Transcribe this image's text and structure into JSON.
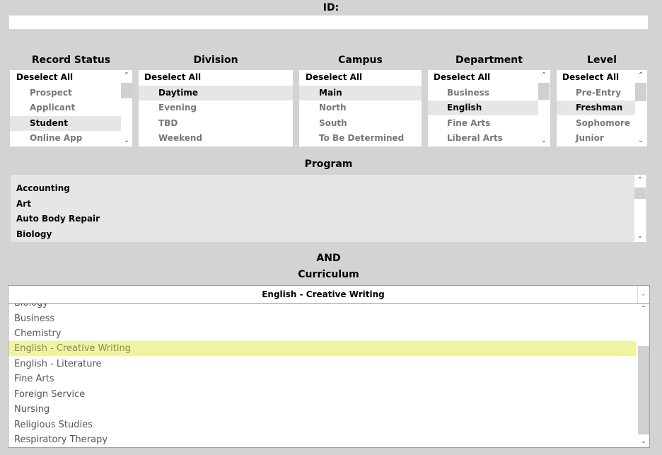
{
  "id_label": "ID:",
  "id_value": "",
  "filters": {
    "record_status": {
      "title": "Record Status",
      "deselect": "Deselect All",
      "items": [
        "Prospect",
        "Applicant",
        "Student",
        "Online App"
      ],
      "selected": "Student"
    },
    "division": {
      "title": "Division",
      "deselect": "Deselect All",
      "items": [
        "Daytime",
        "Evening",
        "TBD",
        "Weekend"
      ],
      "selected": "Daytime"
    },
    "campus": {
      "title": "Campus",
      "deselect": "Deselect All",
      "items": [
        "Main",
        "North",
        "South",
        "To Be Determined"
      ],
      "selected": "Main"
    },
    "department": {
      "title": "Department",
      "deselect": "Deselect All",
      "items": [
        "Business",
        "English",
        "Fine Arts",
        "Liberal Arts"
      ],
      "selected": "English"
    },
    "level": {
      "title": "Level",
      "deselect": "Deselect All",
      "items": [
        "Pre-Entry",
        "Freshman",
        "Sophomore",
        "Junior"
      ],
      "selected": "Freshman"
    }
  },
  "program": {
    "title": "Program",
    "items": [
      "Accounting",
      "Art",
      "Auto Body Repair",
      "Biology"
    ]
  },
  "and_label": "AND",
  "curriculum": {
    "title": "Curriculum",
    "selected_value": "English - Creative Writing",
    "partial_item": "Biology",
    "items": [
      "Business",
      "Chemistry",
      "English - Creative Writing",
      "English - Literature",
      "Fine Arts",
      "Foreign Service",
      "Nursing",
      "Religious Studies",
      "Respiratory Therapy"
    ],
    "highlighted": "English - Creative Writing"
  },
  "icons": {
    "scroll_up": "chevron-up-icon",
    "scroll_down": "chevron-down-icon",
    "dropdown": "chevron-down-icon"
  }
}
